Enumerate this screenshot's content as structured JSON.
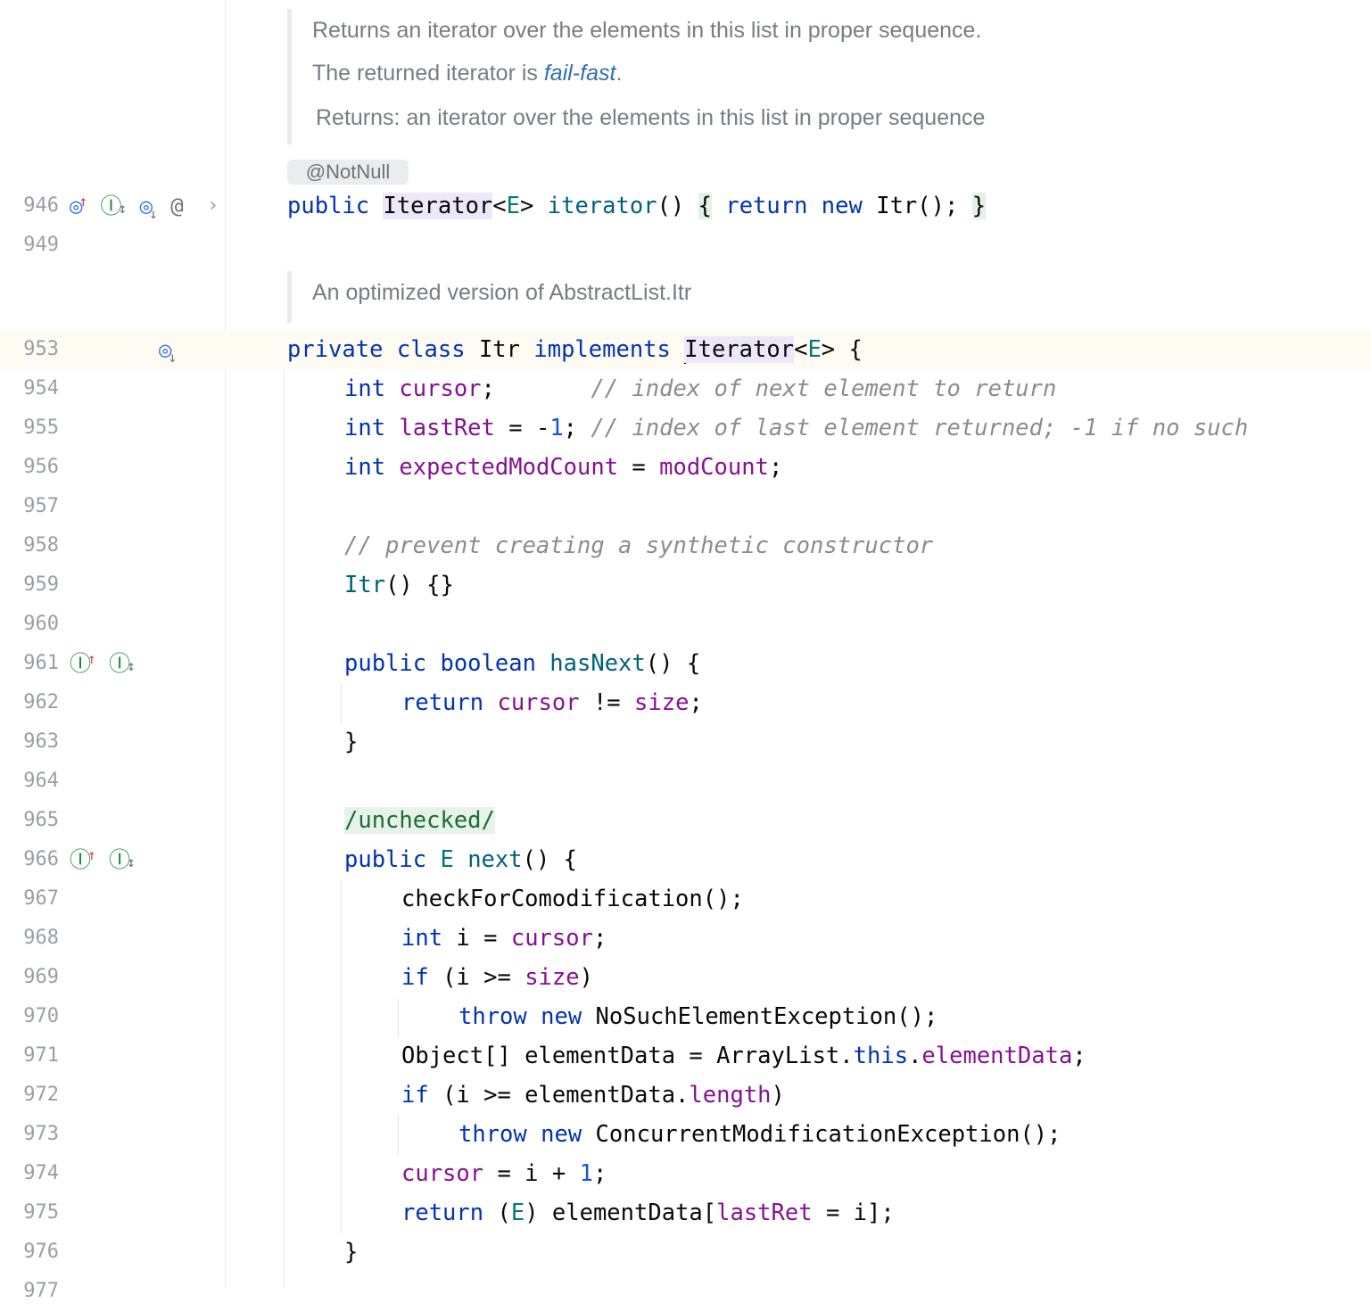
{
  "doc_iterator": {
    "line1": "Returns an iterator over the elements in this list in proper sequence.",
    "line2_prefix": "The returned iterator is ",
    "line2_link": "fail-fast",
    "line2_suffix": ".",
    "returns_label": "Returns:",
    "returns_text": "an iterator over the elements in this list in proper sequence"
  },
  "annotation_hint": "@NotNull",
  "doc_itr": {
    "line1": "An optimized version of AbstractList.Itr"
  },
  "lines": [
    {
      "n": "946"
    },
    {
      "n": "949"
    },
    {
      "n": "953"
    },
    {
      "n": "954"
    },
    {
      "n": "955"
    },
    {
      "n": "956"
    },
    {
      "n": "957"
    },
    {
      "n": "958"
    },
    {
      "n": "959"
    },
    {
      "n": "960"
    },
    {
      "n": "961"
    },
    {
      "n": "962"
    },
    {
      "n": "963"
    },
    {
      "n": "964"
    },
    {
      "n": "965"
    },
    {
      "n": "966"
    },
    {
      "n": "967"
    },
    {
      "n": "968"
    },
    {
      "n": "969"
    },
    {
      "n": "970"
    },
    {
      "n": "971"
    },
    {
      "n": "972"
    },
    {
      "n": "973"
    },
    {
      "n": "974"
    },
    {
      "n": "975"
    },
    {
      "n": "976"
    },
    {
      "n": "977"
    }
  ],
  "code": {
    "l946": {
      "t0": "public ",
      "t1": "Iterator",
      "t2": "<",
      "t3": "E",
      "t4": "> ",
      "t5": "iterator",
      "t6": "() ",
      "t7": "{",
      "t8": " return new ",
      "t9": "Itr(); ",
      "t10": "}"
    },
    "l953": {
      "t0": "private class ",
      "t1": "Itr ",
      "t2": "implements ",
      "t3": "Iterator",
      "t4": "<",
      "t5": "E",
      "t6": "> {"
    },
    "l954": {
      "t0": "int ",
      "t1": "cursor",
      "t2": ";       ",
      "t3": "// index of next element to return"
    },
    "l955": {
      "t0": "int ",
      "t1": "lastRet",
      "t2": " = -",
      "t3": "1",
      "t4": "; ",
      "t5": "// index of last element returned; -1 if no such"
    },
    "l956": {
      "t0": "int ",
      "t1": "expectedModCount",
      "t2": " = ",
      "t3": "modCount",
      "t4": ";"
    },
    "l958": {
      "t0": "// prevent creating a synthetic constructor"
    },
    "l959": {
      "t0": "Itr",
      "t1": "() {}"
    },
    "l961": {
      "t0": "public boolean ",
      "t1": "hasNext",
      "t2": "() {"
    },
    "l962": {
      "t0": "return ",
      "t1": "cursor",
      "t2": " != ",
      "t3": "size",
      "t4": ";"
    },
    "l963": {
      "t0": "}"
    },
    "l965": {
      "t0": "/unchecked/"
    },
    "l966": {
      "t0": "public ",
      "t1": "E ",
      "t2": "next",
      "t3": "() {"
    },
    "l967": {
      "t0": "checkForComodification();"
    },
    "l968": {
      "t0": "int ",
      "t1": "i = ",
      "t2": "cursor",
      "t3": ";"
    },
    "l969": {
      "t0": "if ",
      "t1": "(i >= ",
      "t2": "size",
      "t3": ")"
    },
    "l970": {
      "t0": "throw new ",
      "t1": "NoSuchElementException();"
    },
    "l971": {
      "t0": "Object[] elementData = ArrayList.",
      "t1": "this",
      "t2": ".",
      "t3": "elementData",
      "t4": ";"
    },
    "l972": {
      "t0": "if ",
      "t1": "(i >= elementData.",
      "t2": "length",
      "t3": ")"
    },
    "l973": {
      "t0": "throw new ",
      "t1": "ConcurrentModificationException();"
    },
    "l974": {
      "t0": "cursor",
      "t1": " = i + ",
      "t2": "1",
      "t3": ";"
    },
    "l975": {
      "t0": "return ",
      "t1": "(",
      "t2": "E",
      "t3": ") elementData[",
      "t4": "lastRet",
      "t5": " = i];"
    },
    "l976": {
      "t0": "}"
    }
  },
  "gutter_icons": {
    "g946": [
      "overrides-method-icon",
      "implements-method-icon",
      "overridden-method-icon",
      "annotation-icon",
      "fold-chevron-icon"
    ],
    "g953": [
      "overridden-class-icon"
    ],
    "g961": [
      "implements-method-icon",
      "implements-method-icon"
    ],
    "g966": [
      "implements-method-icon",
      "implements-method-icon"
    ]
  },
  "colors": {
    "keyword": "#0033b3",
    "field": "#871094",
    "method": "#00627a",
    "type_param": "#00787a",
    "number": "#1750eb",
    "comment": "#8c8c8c",
    "current_line": "#fefcf2"
  }
}
